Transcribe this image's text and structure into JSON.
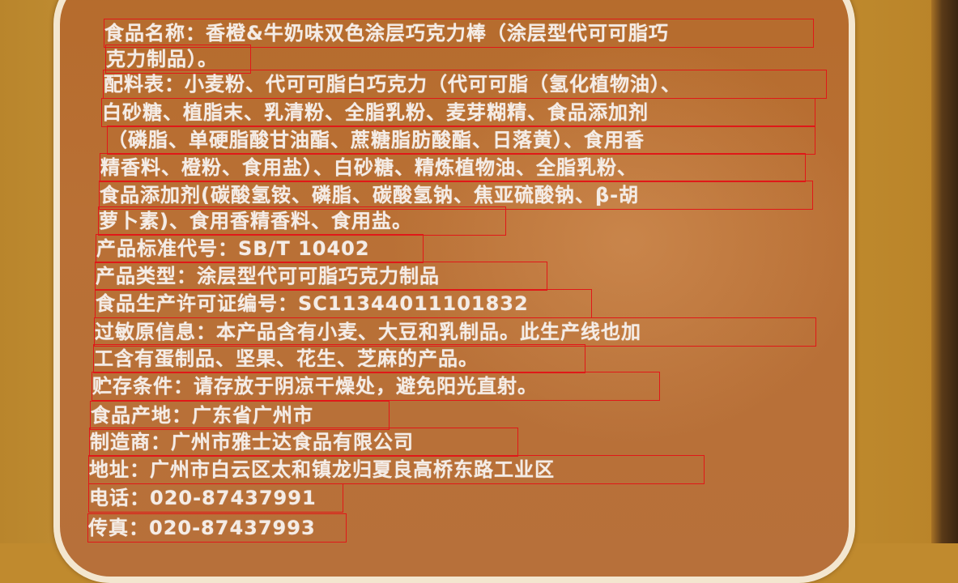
{
  "lines": [
    "食品名称：香橙&牛奶味双色涂层巧克力棒（涂层型代可可脂巧",
    "克力制品）。",
    "配料表：小麦粉、代可可脂白巧克力（代可可脂（氢化植物油）、",
    "白砂糖、植脂末、乳清粉、全脂乳粉、麦芽糊精、食品添加剂",
    "（磷脂、单硬脂酸甘油酯、蔗糖脂肪酸酯、日落黄）、食用香",
    "精香料、橙粉、食用盐）、白砂糖、精炼植物油、全脂乳粉、",
    "食品添加剂(碳酸氢铵、磷脂、碳酸氢钠、焦亚硫酸钠、β-胡",
    "萝卜素)、食用香精香料、食用盐。",
    "产品标准代号：SB/T 10402",
    "产品类型：涂层型代可可脂巧克力制品",
    "食品生产许可证编号：SC11344011101832",
    "过敏原信息：本产品含有小麦、大豆和乳制品。此生产线也加",
    "工含有蛋制品、坚果、花生、芝麻的产品。",
    "贮存条件：请存放于阴凉干燥处，避免阳光直射。",
    "食品产地：广东省广州市",
    "制造商：广州市雅士达食品有限公司",
    "地址：广州市白云区太和镇龙归夏良高桥东路工业区",
    "电话：020-87437991",
    "传真：020-87437993"
  ]
}
